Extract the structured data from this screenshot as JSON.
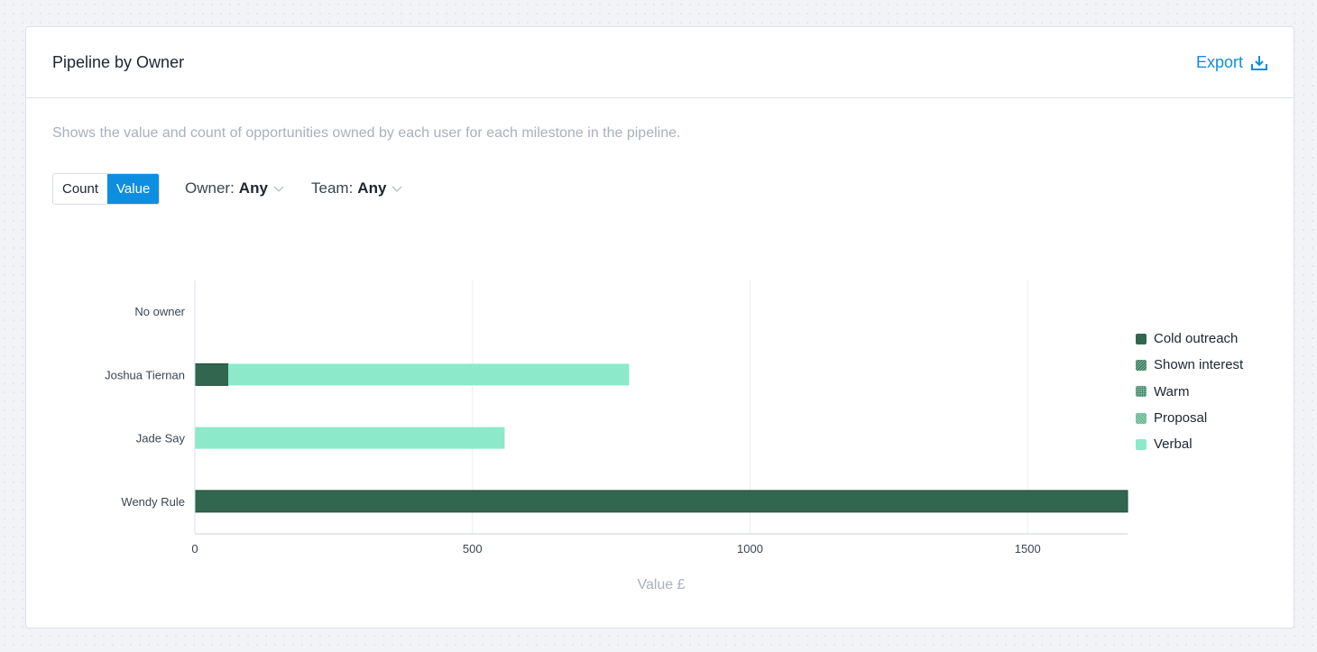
{
  "header": {
    "title": "Pipeline by Owner",
    "export_label": "Export"
  },
  "description": "Shows the value and count of opportunities owned by each user for each milestone in the pipeline.",
  "toggle": {
    "options": [
      "Count",
      "Value"
    ],
    "selected": "Value"
  },
  "filters": {
    "owner": {
      "label": "Owner:",
      "value": "Any"
    },
    "team": {
      "label": "Team:",
      "value": "Any"
    }
  },
  "chart_data": {
    "type": "bar",
    "orientation": "horizontal",
    "stacked": true,
    "title": "",
    "xlabel": "Value £",
    "ylabel": "",
    "xlim": [
      0,
      1680
    ],
    "xticks": [
      0,
      500,
      1000,
      1500
    ],
    "grid": true,
    "legend_position": "right",
    "categories": [
      "No owner",
      "Joshua Tiernan",
      "Jade Say",
      "Wendy Rule"
    ],
    "series": [
      {
        "name": "Cold outreach",
        "color": "#31664f",
        "pattern": "solid",
        "values": [
          0,
          60,
          0,
          1680
        ]
      },
      {
        "name": "Shown interest",
        "color": "#3d7a60",
        "pattern": "diagonal",
        "values": [
          0,
          0,
          0,
          0
        ]
      },
      {
        "name": "Warm",
        "color": "#4a8d71",
        "pattern": "dots",
        "values": [
          0,
          0,
          0,
          0
        ]
      },
      {
        "name": "Proposal",
        "color": "#62b38f",
        "pattern": "crosshatch",
        "values": [
          0,
          0,
          0,
          0
        ]
      },
      {
        "name": "Verbal",
        "color": "#8ce9c9",
        "pattern": "solid",
        "values": [
          0,
          722,
          558,
          0
        ]
      }
    ]
  }
}
